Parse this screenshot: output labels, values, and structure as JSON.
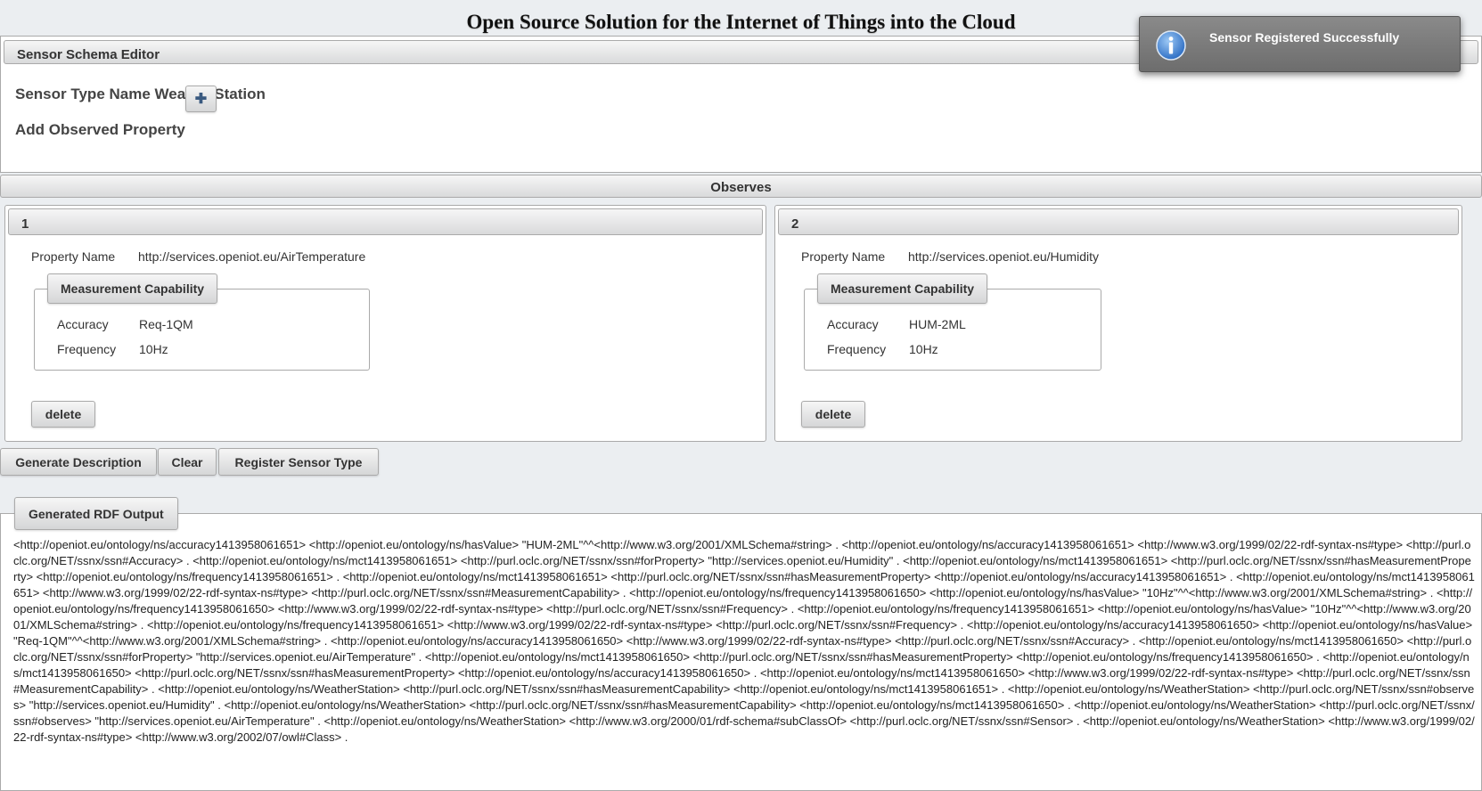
{
  "page": {
    "title": "Open Source Solution for the Internet of Things into the Cloud"
  },
  "schema_editor": {
    "header": "Sensor Schema Editor",
    "sensor_type_label": "Sensor Type Name WeatherStation",
    "add_property_label": "Add Observed Property",
    "add_button_icon": "plus-icon"
  },
  "observes": {
    "header": "Observes",
    "items": [
      {
        "index": "1",
        "property_name_label": "Property Name",
        "property_name_value": "http://services.openiot.eu/AirTemperature",
        "capability_legend": "Measurement Capability",
        "accuracy_label": "Accuracy",
        "accuracy_value": "Req-1QM",
        "frequency_label": "Frequency",
        "frequency_value": "10Hz",
        "delete_label": "delete"
      },
      {
        "index": "2",
        "property_name_label": "Property Name",
        "property_name_value": "http://services.openiot.eu/Humidity",
        "capability_legend": "Measurement Capability",
        "accuracy_label": "Accuracy",
        "accuracy_value": "HUM-2ML",
        "frequency_label": "Frequency",
        "frequency_value": "10Hz",
        "delete_label": "delete"
      }
    ]
  },
  "actions": {
    "generate": "Generate Description",
    "clear": "Clear",
    "register": "Register Sensor Type"
  },
  "rdf": {
    "legend": "Generated RDF Output",
    "text": "<http://openiot.eu/ontology/ns/accuracy1413958061651> <http://openiot.eu/ontology/ns/hasValue> \"HUM-2ML\"^^<http://www.w3.org/2001/XMLSchema#string> . <http://openiot.eu/ontology/ns/accuracy1413958061651> <http://www.w3.org/1999/02/22-rdf-syntax-ns#type> <http://purl.oclc.org/NET/ssnx/ssn#Accuracy> . <http://openiot.eu/ontology/ns/mct1413958061651> <http://purl.oclc.org/NET/ssnx/ssn#forProperty> \"http://services.openiot.eu/Humidity\" . <http://openiot.eu/ontology/ns/mct1413958061651> <http://purl.oclc.org/NET/ssnx/ssn#hasMeasurementProperty> <http://openiot.eu/ontology/ns/frequency1413958061651> . <http://openiot.eu/ontology/ns/mct1413958061651> <http://purl.oclc.org/NET/ssnx/ssn#hasMeasurementProperty> <http://openiot.eu/ontology/ns/accuracy1413958061651> . <http://openiot.eu/ontology/ns/mct1413958061651> <http://www.w3.org/1999/02/22-rdf-syntax-ns#type> <http://purl.oclc.org/NET/ssnx/ssn#MeasurementCapability> . <http://openiot.eu/ontology/ns/frequency1413958061650> <http://openiot.eu/ontology/ns/hasValue> \"10Hz\"^^<http://www.w3.org/2001/XMLSchema#string> . <http://openiot.eu/ontology/ns/frequency1413958061650> <http://www.w3.org/1999/02/22-rdf-syntax-ns#type> <http://purl.oclc.org/NET/ssnx/ssn#Frequency> . <http://openiot.eu/ontology/ns/frequency1413958061651> <http://openiot.eu/ontology/ns/hasValue> \"10Hz\"^^<http://www.w3.org/2001/XMLSchema#string> . <http://openiot.eu/ontology/ns/frequency1413958061651> <http://www.w3.org/1999/02/22-rdf-syntax-ns#type> <http://purl.oclc.org/NET/ssnx/ssn#Frequency> . <http://openiot.eu/ontology/ns/accuracy1413958061650> <http://openiot.eu/ontology/ns/hasValue> \"Req-1QM\"^^<http://www.w3.org/2001/XMLSchema#string> . <http://openiot.eu/ontology/ns/accuracy1413958061650> <http://www.w3.org/1999/02/22-rdf-syntax-ns#type> <http://purl.oclc.org/NET/ssnx/ssn#Accuracy> . <http://openiot.eu/ontology/ns/mct1413958061650> <http://purl.oclc.org/NET/ssnx/ssn#forProperty> \"http://services.openiot.eu/AirTemperature\" . <http://openiot.eu/ontology/ns/mct1413958061650> <http://purl.oclc.org/NET/ssnx/ssn#hasMeasurementProperty> <http://openiot.eu/ontology/ns/frequency1413958061650> . <http://openiot.eu/ontology/ns/mct1413958061650> <http://purl.oclc.org/NET/ssnx/ssn#hasMeasurementProperty> <http://openiot.eu/ontology/ns/accuracy1413958061650> . <http://openiot.eu/ontology/ns/mct1413958061650> <http://www.w3.org/1999/02/22-rdf-syntax-ns#type> <http://purl.oclc.org/NET/ssnx/ssn#MeasurementCapability> . <http://openiot.eu/ontology/ns/WeatherStation> <http://purl.oclc.org/NET/ssnx/ssn#hasMeasurementCapability> <http://openiot.eu/ontology/ns/mct1413958061651> . <http://openiot.eu/ontology/ns/WeatherStation> <http://purl.oclc.org/NET/ssnx/ssn#observes> \"http://services.openiot.eu/Humidity\" . <http://openiot.eu/ontology/ns/WeatherStation> <http://purl.oclc.org/NET/ssnx/ssn#hasMeasurementCapability> <http://openiot.eu/ontology/ns/mct1413958061650> . <http://openiot.eu/ontology/ns/WeatherStation> <http://purl.oclc.org/NET/ssnx/ssn#observes> \"http://services.openiot.eu/AirTemperature\" . <http://openiot.eu/ontology/ns/WeatherStation> <http://www.w3.org/2000/01/rdf-schema#subClassOf> <http://purl.oclc.org/NET/ssnx/ssn#Sensor> . <http://openiot.eu/ontology/ns/WeatherStation> <http://www.w3.org/1999/02/22-rdf-syntax-ns#type> <http://www.w3.org/2002/07/owl#Class> ."
  },
  "notification": {
    "icon": "info-icon",
    "message": "Sensor Registered Successfully"
  },
  "colors": {
    "background": "#ebeef1",
    "header_gradient_top": "#f6f6f6",
    "header_gradient_bottom": "#d9dadb",
    "toast_background": "#7a7a7a",
    "info_icon_blue": "#3b7ed3"
  }
}
